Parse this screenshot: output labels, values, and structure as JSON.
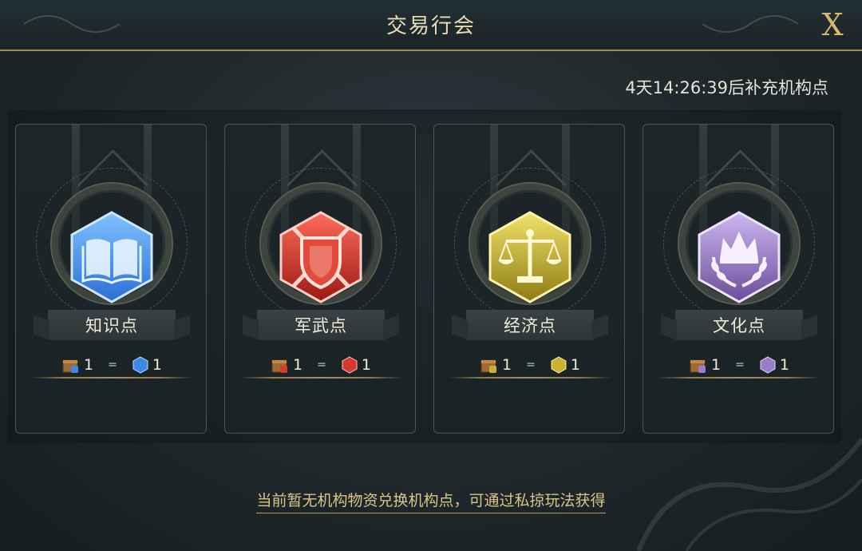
{
  "header": {
    "title": "交易行会",
    "close_label": "X"
  },
  "timer": {
    "text": "4天14:26:39后补充机构点"
  },
  "cards": [
    {
      "name": "知识点",
      "emblem": "book-icon",
      "color": "#3b88e6",
      "rate_left": "1",
      "rate_right": "1"
    },
    {
      "name": "军武点",
      "emblem": "shield-swords-icon",
      "color": "#d63a2e",
      "rate_left": "1",
      "rate_right": "1"
    },
    {
      "name": "经济点",
      "emblem": "scales-icon",
      "color": "#c9b22e",
      "rate_left": "1",
      "rate_right": "1"
    },
    {
      "name": "文化点",
      "emblem": "crown-laurel-icon",
      "color": "#9a7cc8",
      "rate_left": "1",
      "rate_right": "1"
    }
  ],
  "rate_equals": "=",
  "footer": {
    "notice": "当前暂无机构物资兑换机构点，可通过私掠玩法获得"
  }
}
